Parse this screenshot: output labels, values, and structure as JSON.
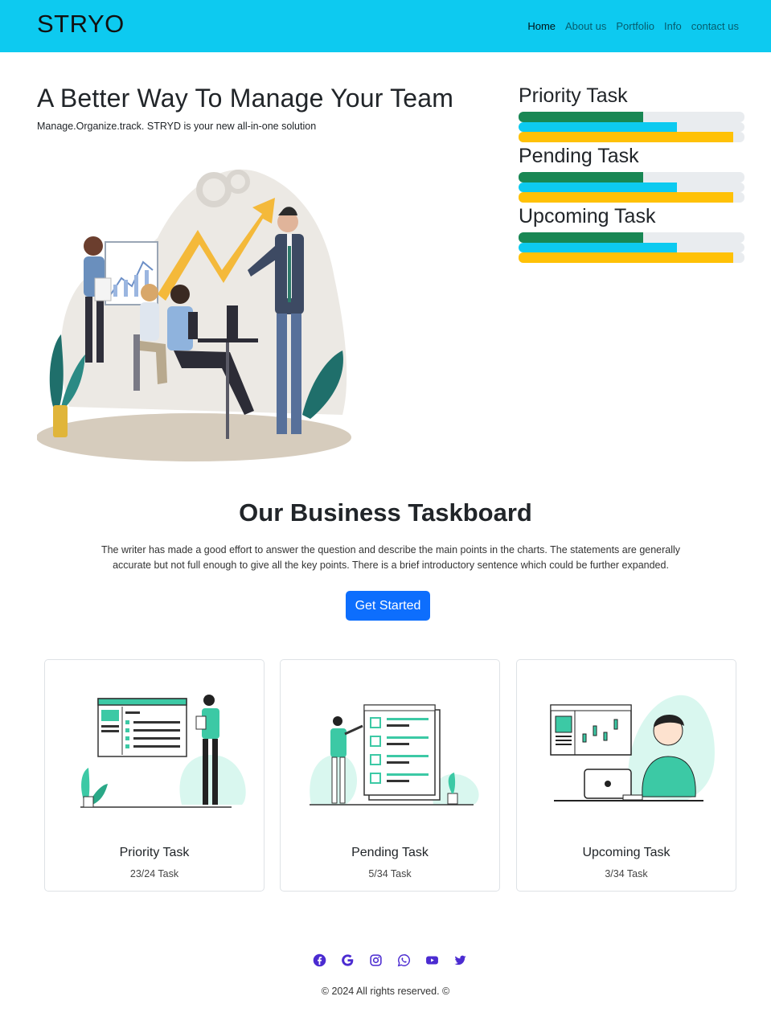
{
  "navbar": {
    "brand": "STRYO",
    "links": [
      {
        "label": "Home",
        "active": true
      },
      {
        "label": "About us",
        "active": false
      },
      {
        "label": "Portfolio",
        "active": false
      },
      {
        "label": "Info",
        "active": false
      },
      {
        "label": "contact us",
        "active": false
      }
    ]
  },
  "hero": {
    "title": "A Better Way To Manage Your Team",
    "subtitle": "Manage.Organize.track. STRYD is your new all-in-one solution"
  },
  "progress_panel": [
    {
      "title": "Priority Task",
      "bars": [
        {
          "percent": 55,
          "color": "#198754"
        },
        {
          "percent": 70,
          "color": "#0dcaf0"
        },
        {
          "percent": 95,
          "color": "#ffc107"
        }
      ]
    },
    {
      "title": "Pending Task",
      "bars": [
        {
          "percent": 55,
          "color": "#198754"
        },
        {
          "percent": 70,
          "color": "#0dcaf0"
        },
        {
          "percent": 95,
          "color": "#ffc107"
        }
      ]
    },
    {
      "title": "Upcoming Task",
      "bars": [
        {
          "percent": 55,
          "color": "#198754"
        },
        {
          "percent": 70,
          "color": "#0dcaf0"
        },
        {
          "percent": 95,
          "color": "#ffc107"
        }
      ]
    }
  ],
  "section": {
    "title": "Our Business Taskboard",
    "description": "The writer has made a good effort to answer the question and describe the main points in the charts. The statements are generally accurate but not full enough to give all the key points. There is a brief introductory sentence which could be further expanded.",
    "cta_label": "Get Started"
  },
  "cards": [
    {
      "title": "Priority Task",
      "count": "23/24 Task"
    },
    {
      "title": "Pending Task",
      "count": "5/34 Task"
    },
    {
      "title": "Upcoming Task",
      "count": "3/34 Task"
    }
  ],
  "footer": {
    "social_icons": [
      "facebook-icon",
      "google-icon",
      "instagram-icon",
      "whatsapp-icon",
      "youtube-icon",
      "twitter-icon"
    ],
    "icon_color": "#4b2bd1",
    "copyright": "© 2024 All rights reserved. ©"
  },
  "colors": {
    "navbar": "#0dcaf0",
    "primary": "#0d6efd",
    "accent_teal": "#3cc9a5"
  }
}
